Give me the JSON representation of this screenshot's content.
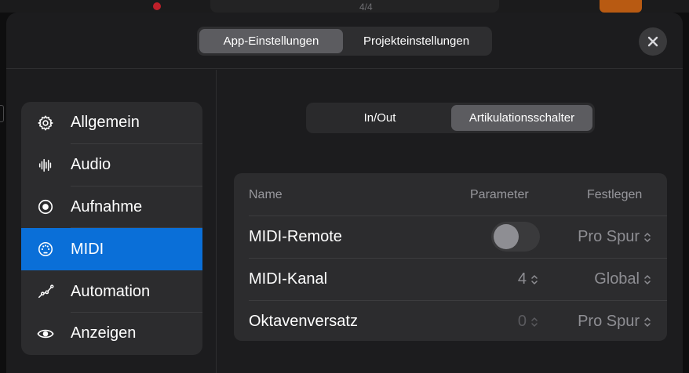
{
  "background": {
    "time_signature": "4/4"
  },
  "header": {
    "tabs": [
      {
        "label": "App-Einstellungen",
        "active": true
      },
      {
        "label": "Projekteinstellungen",
        "active": false
      }
    ],
    "close_icon": "xmark-icon"
  },
  "sidebar": {
    "items": [
      {
        "label": "Allgemein",
        "icon": "gear-icon",
        "active": false
      },
      {
        "label": "Audio",
        "icon": "waveform-icon",
        "active": false
      },
      {
        "label": "Aufnahme",
        "icon": "record-icon",
        "active": false
      },
      {
        "label": "MIDI",
        "icon": "midi-icon",
        "active": true
      },
      {
        "label": "Automation",
        "icon": "automation-icon",
        "active": false
      },
      {
        "label": "Anzeigen",
        "icon": "eye-icon",
        "active": false
      }
    ]
  },
  "main": {
    "tabs": [
      {
        "label": "In/Out",
        "active": false
      },
      {
        "label": "Artikulationsschalter",
        "active": true
      }
    ],
    "table": {
      "headers": {
        "name": "Name",
        "parameter": "Parameter",
        "festlegen": "Festlegen"
      },
      "rows": [
        {
          "name": "MIDI-Remote",
          "parameter_type": "toggle",
          "parameter_on": false,
          "festlegen": "Pro Spur"
        },
        {
          "name": "MIDI-Kanal",
          "parameter": "4",
          "festlegen": "Global"
        },
        {
          "name": "Oktavenversatz",
          "parameter": "0",
          "festlegen": "Pro Spur"
        }
      ]
    }
  },
  "colors": {
    "accent": "#0a6fd8",
    "modal_bg": "#1c1c1e",
    "card_bg": "#2c2c2e"
  }
}
